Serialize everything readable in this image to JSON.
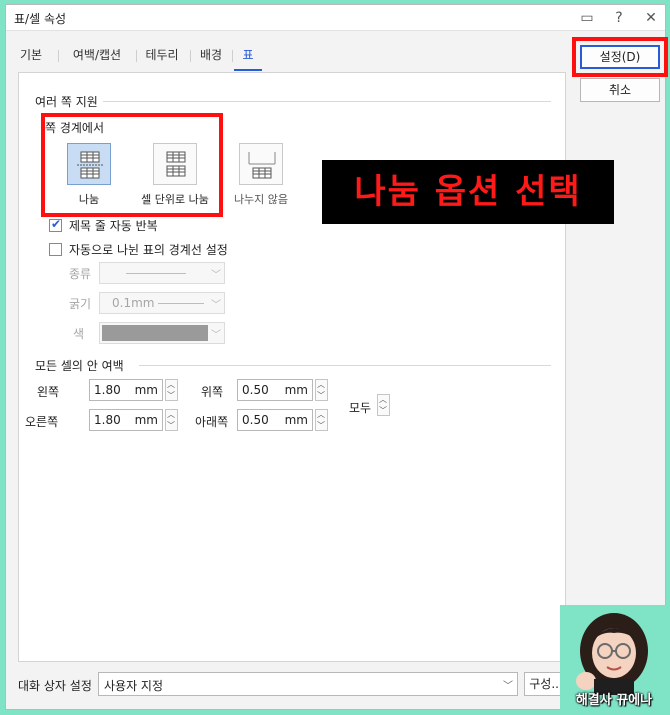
{
  "window": {
    "title": "표/셀 속성",
    "help": "?",
    "close": "✕",
    "comment": "▭"
  },
  "tabs": [
    {
      "label": "기본"
    },
    {
      "label": "여백/캡션"
    },
    {
      "label": "테두리"
    },
    {
      "label": "배경"
    },
    {
      "label": "표"
    }
  ],
  "active_tab": "표",
  "multi_page": {
    "title": "여러 쪽 지원",
    "boundary_title": "쪽 경계에서",
    "options": [
      {
        "label": "나눔",
        "selected": true
      },
      {
        "label": "셀 단위로 나눔",
        "selected": false
      },
      {
        "label": "나누지 않음",
        "selected": false
      }
    ],
    "repeat_header": {
      "label": "제목 줄 자동 반복",
      "checked": true
    },
    "auto_border": {
      "label": "자동으로 나뉜 표의 경계선 설정",
      "checked": false
    },
    "type_label": "종류",
    "thickness_label": "굵기",
    "thickness_value": "0.1mm",
    "color_label": "색",
    "line_color": "#9a9a9a"
  },
  "cell_margins": {
    "title": "모든 셀의 안 여백",
    "left": {
      "label": "왼쪽",
      "value": "1.80",
      "unit": "mm"
    },
    "right": {
      "label": "오른쪽",
      "value": "1.80",
      "unit": "mm"
    },
    "top": {
      "label": "위쪽",
      "value": "0.50",
      "unit": "mm"
    },
    "bottom": {
      "label": "아래쪽",
      "value": "0.50",
      "unit": "mm"
    },
    "all_label": "모두"
  },
  "side_buttons": {
    "ok": "설정(D)",
    "cancel": "취소"
  },
  "footer": {
    "label": "대화 상자 설정",
    "value": "사용자 지정",
    "config_button": "구성..."
  },
  "annotation": {
    "banner": "나눔 옵션 선택",
    "highlight_color": "#ff1010"
  },
  "watermark": {
    "caption": "해결사 뀨에나"
  }
}
